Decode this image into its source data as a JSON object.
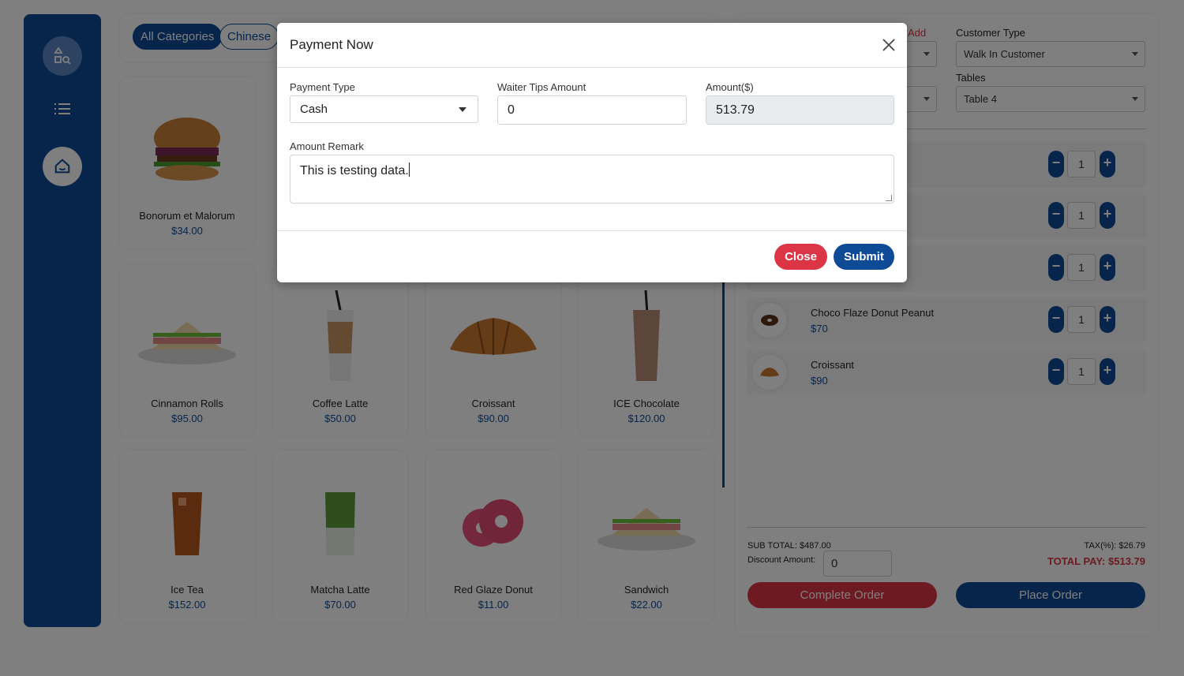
{
  "categories": [
    {
      "label": "All Categories",
      "active": true
    },
    {
      "label": "Chinese",
      "active": false
    }
  ],
  "products": [
    {
      "name": "Bonorum et Malorum",
      "price": "$34.00",
      "icon": "burger-image"
    },
    {
      "name": "Cinnamon Rolls",
      "price": "$95.00",
      "icon": "sandwich-image"
    },
    {
      "name": "Coffee Latte",
      "price": "$50.00",
      "icon": "iced-coffee-image"
    },
    {
      "name": "Croissant",
      "price": "$90.00",
      "icon": "croissant-image"
    },
    {
      "name": "ICE Chocolate",
      "price": "$120.00",
      "icon": "iced-chocolate-image"
    },
    {
      "name": "Ice Tea",
      "price": "$152.00",
      "icon": "iced-tea-image"
    },
    {
      "name": "Matcha Latte",
      "price": "$70.00",
      "icon": "matcha-image"
    },
    {
      "name": "Red Glaze Donut",
      "price": "$11.00",
      "icon": "donut-image"
    },
    {
      "name": "Sandwich",
      "price": "$22.00",
      "icon": "sandwich-image"
    }
  ],
  "panel": {
    "add_label": "Add",
    "customer_type_label": "Customer Type",
    "customer_type_value": "Walk In Customer",
    "tables_label": "Tables",
    "tables_value": "Table 4",
    "cart": [
      {
        "name": "",
        "price": "",
        "qty": "1"
      },
      {
        "name": "",
        "price": "",
        "qty": "1"
      },
      {
        "name": "",
        "price": "",
        "qty": "1"
      },
      {
        "name": "Choco Flaze Donut Peanut",
        "price": "$70",
        "qty": "1"
      },
      {
        "name": "Croissant",
        "price": "$90",
        "qty": "1"
      }
    ],
    "sub_total": "SUB TOTAL: $487.00",
    "discount_label": "Discount Amount:",
    "discount_value": "0",
    "tax": "TAX(%): $26.79",
    "total_pay": "TOTAL PAY: $513.79",
    "complete_order": "Complete Order",
    "place_order": "Place Order"
  },
  "modal": {
    "title": "Payment Now",
    "payment_type_label": "Payment Type",
    "payment_type_value": "Cash",
    "tips_label": "Waiter Tips Amount",
    "tips_value": "0",
    "amount_label": "Amount($)",
    "amount_value": "513.79",
    "remark_label": "Amount Remark",
    "remark_value": "This is testing data.",
    "close_label": "Close",
    "submit_label": "Submit"
  },
  "colors": {
    "primary": "#0e4a96",
    "danger": "#dc3545"
  }
}
